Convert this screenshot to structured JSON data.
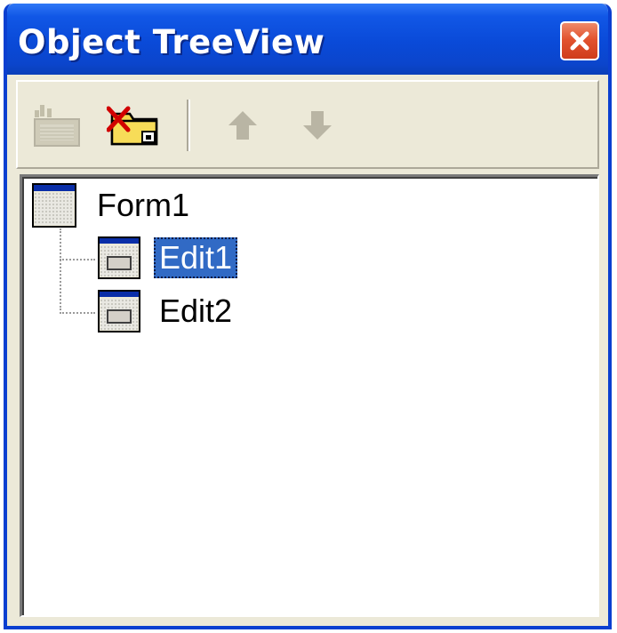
{
  "window": {
    "title": "Object TreeView",
    "close_label": "Close"
  },
  "toolbar": {
    "buttons": [
      {
        "icon": "add-object-icon",
        "enabled": false
      },
      {
        "icon": "delete-object-icon",
        "enabled": true
      },
      {
        "icon": "move-up-icon",
        "enabled": false
      },
      {
        "icon": "move-down-icon",
        "enabled": false
      }
    ]
  },
  "tree": {
    "root": {
      "label": "Form1",
      "icon": "form-icon"
    },
    "children": [
      {
        "label": "Edit1",
        "icon": "edit-control-icon",
        "selected": true
      },
      {
        "label": "Edit2",
        "icon": "edit-control-icon",
        "selected": false
      }
    ]
  },
  "colors": {
    "title_bar": "#0a4ad8",
    "selection": "#316ac5",
    "face": "#ece9d8",
    "close_button": "#e2532f"
  }
}
